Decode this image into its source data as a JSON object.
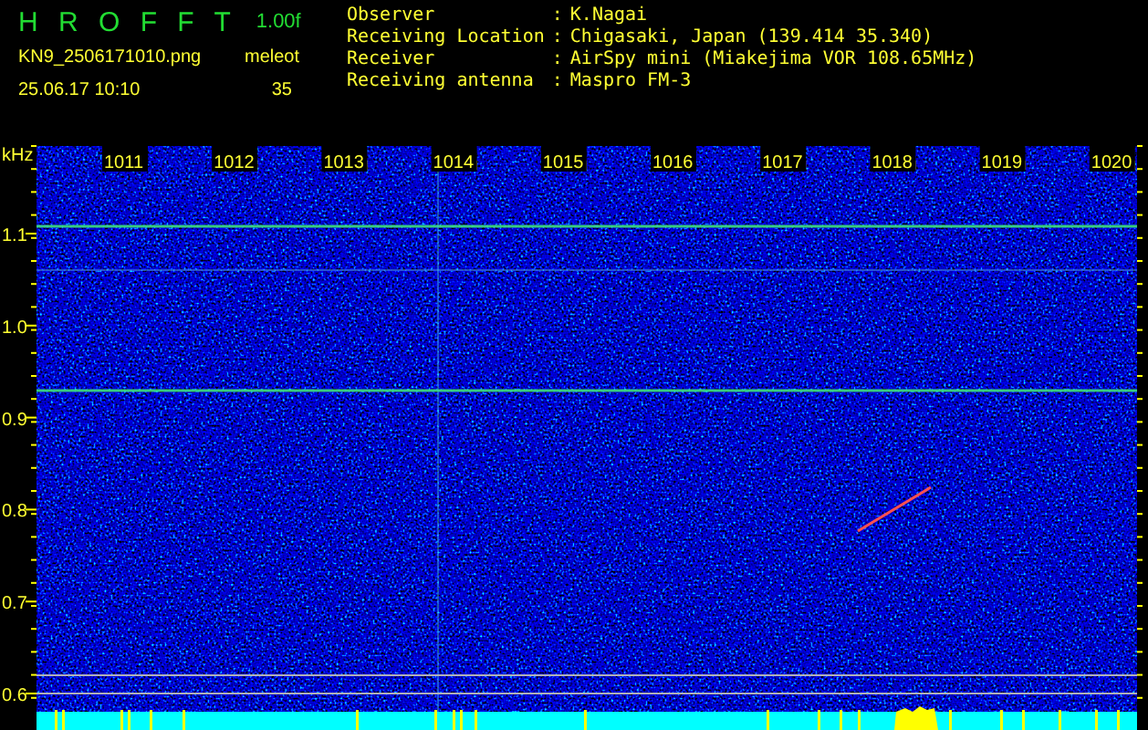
{
  "header": {
    "title": "H R O F F T",
    "version": "1.00f",
    "filename": "KN9_2506171010.png",
    "timestamp": "25.06.17 10:10",
    "mode_label": "meleot",
    "count": "35"
  },
  "info": [
    {
      "label": "Observer",
      "separator": ":",
      "value": "K.Nagai"
    },
    {
      "label": "Receiving Location",
      "separator": ":",
      "value": "Chigasaki, Japan (139.414 35.340)"
    },
    {
      "label": "Receiver",
      "separator": ":",
      "value": "AirSpy mini (Miakejima VOR 108.65MHz)"
    },
    {
      "label": "Receiving antenna",
      "separator": ":",
      "value": "Maspro FM-3"
    }
  ],
  "spectrogram": {
    "y_unit": "kHz",
    "y_labels": [
      "1.1",
      "1.0",
      "0.9",
      "0.8",
      "0.7",
      "0.6"
    ],
    "x_labels": [
      "1011",
      "1012",
      "1013",
      "1014",
      "1015",
      "1016",
      "1017",
      "1018",
      "1019",
      "1020"
    ]
  }
}
